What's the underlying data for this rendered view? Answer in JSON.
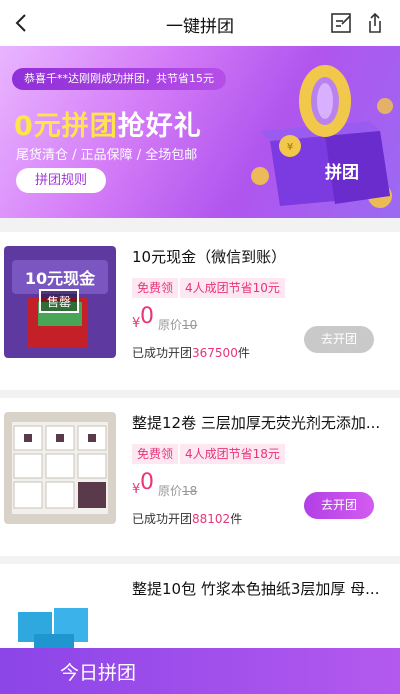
{
  "header": {
    "title": "一键拼团"
  },
  "banner": {
    "notice": "恭喜千**达刚刚成功拼团，共节省15元",
    "headline_part1": "0元拼团",
    "headline_part2": "抢好礼",
    "tagline": "尾货清仓 / 正品保障 / 全场包邮",
    "rules_button": "拼团规则",
    "hero_badge": "拼团"
  },
  "products": [
    {
      "name": "10元现金（微信到账）",
      "tag_free": "免费领",
      "tag_save": "4人成团节省10元",
      "price_symbol": "¥",
      "price": "0",
      "orig_label": "原价",
      "orig_price": "10",
      "sold_prefix": "已成功开团",
      "sold_count": "367500",
      "sold_suffix": "件",
      "button": "去开团",
      "button_enabled": false,
      "thumb_text": "10元现金",
      "thumb_badge": "售罄"
    },
    {
      "name": "整提12卷 三层加厚无荧光剂无添加...",
      "tag_free": "免费领",
      "tag_save": "4人成团节省18元",
      "price_symbol": "¥",
      "price": "0",
      "orig_label": "原价",
      "orig_price": "18",
      "sold_prefix": "已成功开团",
      "sold_count": "88102",
      "sold_suffix": "件",
      "button": "去开团",
      "button_enabled": true
    },
    {
      "name": "整提10包 竹浆本色抽纸3层加厚 母..."
    }
  ],
  "bottom_bar": {
    "label": "今日拼团"
  },
  "colors": {
    "accent": "#e8347a",
    "brand_purple": "#b23fe6"
  }
}
